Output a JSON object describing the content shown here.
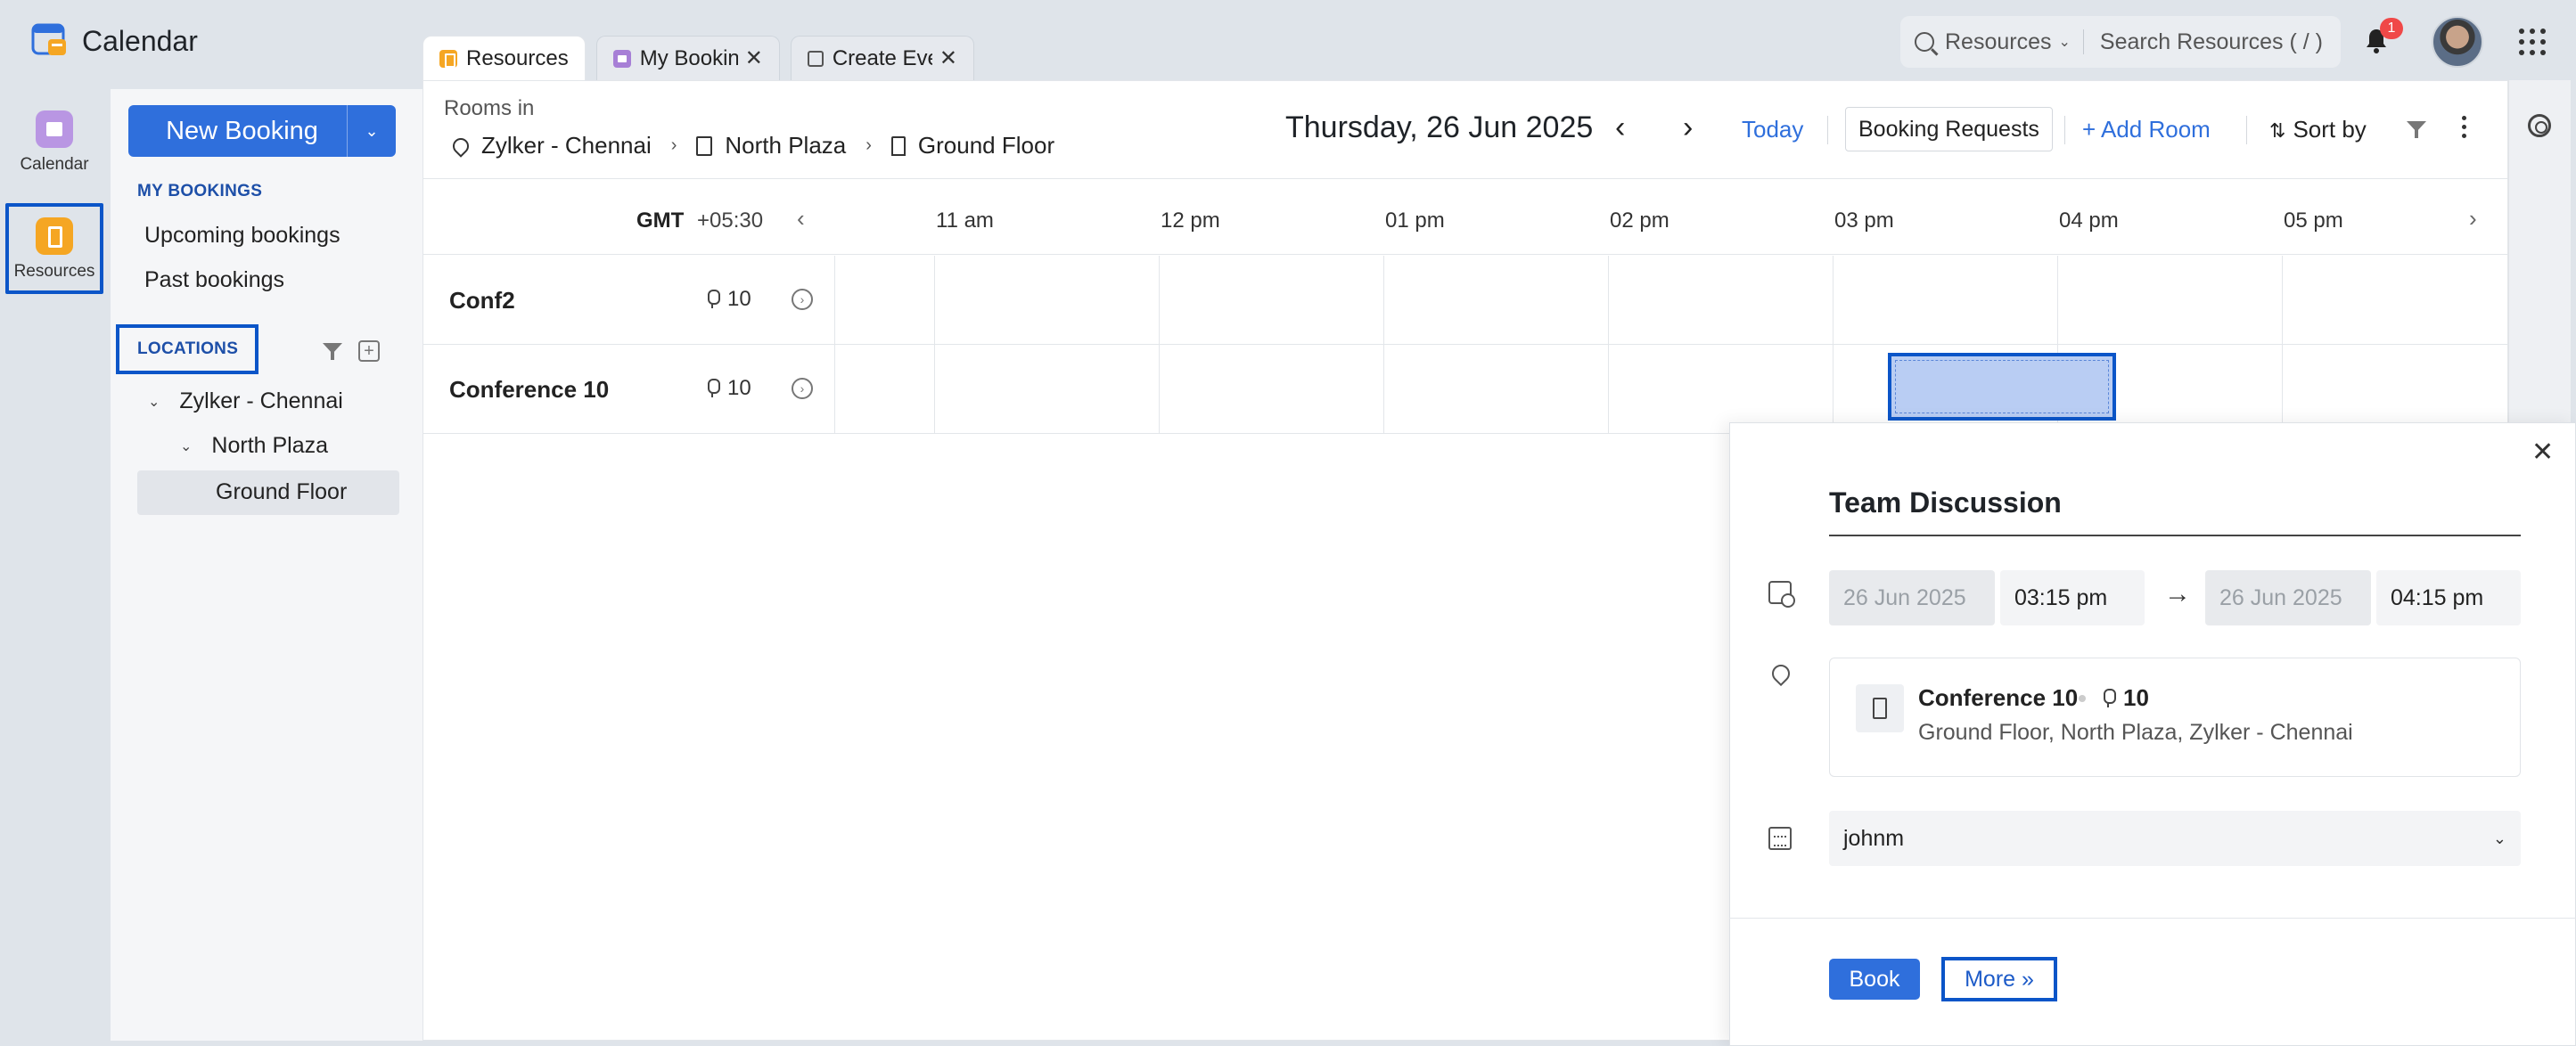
{
  "app": {
    "title": "Calendar"
  },
  "tabs": [
    {
      "label": "Resources",
      "icon": "resources-icon",
      "closable": false
    },
    {
      "label": "My Bookin",
      "icon": "calendar-icon",
      "closable": true
    },
    {
      "label": "Create Eve",
      "icon": "create-event-icon",
      "closable": true
    }
  ],
  "search": {
    "scope": "Resources",
    "placeholder": "Search Resources ( / )"
  },
  "notifications": {
    "count": "1"
  },
  "rail": {
    "calendar_label": "Calendar",
    "resources_label": "Resources"
  },
  "sidebar": {
    "new_booking_label": "New Booking",
    "my_bookings_title": "MY BOOKINGS",
    "upcoming_label": "Upcoming bookings",
    "past_label": "Past bookings",
    "locations_title": "LOCATIONS",
    "tree": {
      "level1": "Zylker - Chennai",
      "level2": "North Plaza",
      "level3": "Ground Floor"
    }
  },
  "header": {
    "rooms_in_label": "Rooms in",
    "breadcrumb": [
      "Zylker - Chennai",
      "North Plaza",
      "Ground Floor"
    ],
    "date_title": "Thursday, 26 Jun 2025",
    "today_label": "Today",
    "booking_requests_label": "Booking Requests",
    "add_room_label": "+ Add Room",
    "sort_by_label": "Sort by"
  },
  "timeline": {
    "gmt_label": "GMT",
    "gmt_offset": "+05:30",
    "hours": [
      "11 am",
      "12 pm",
      "01 pm",
      "02 pm",
      "03 pm",
      "04 pm",
      "05 pm"
    ]
  },
  "rooms": [
    {
      "name": "Conf2",
      "capacity": "10"
    },
    {
      "name": "Conference 10",
      "capacity": "10"
    }
  ],
  "popup": {
    "title": "Team Discussion",
    "start_date": "26 Jun 2025",
    "start_time": "03:15 pm",
    "end_date": "26 Jun 2025",
    "end_time": "04:15 pm",
    "room_name": "Conference 10",
    "room_capacity": "10",
    "room_address": "Ground Floor, North Plaza, Zylker - Chennai",
    "owner": "johnm",
    "book_label": "Book",
    "more_label": "More  »"
  },
  "colors": {
    "accent": "#2f6fdc",
    "highlight_border": "#0b55c8",
    "slot_fill": "#b9cdf3",
    "badge": "#f04848"
  }
}
